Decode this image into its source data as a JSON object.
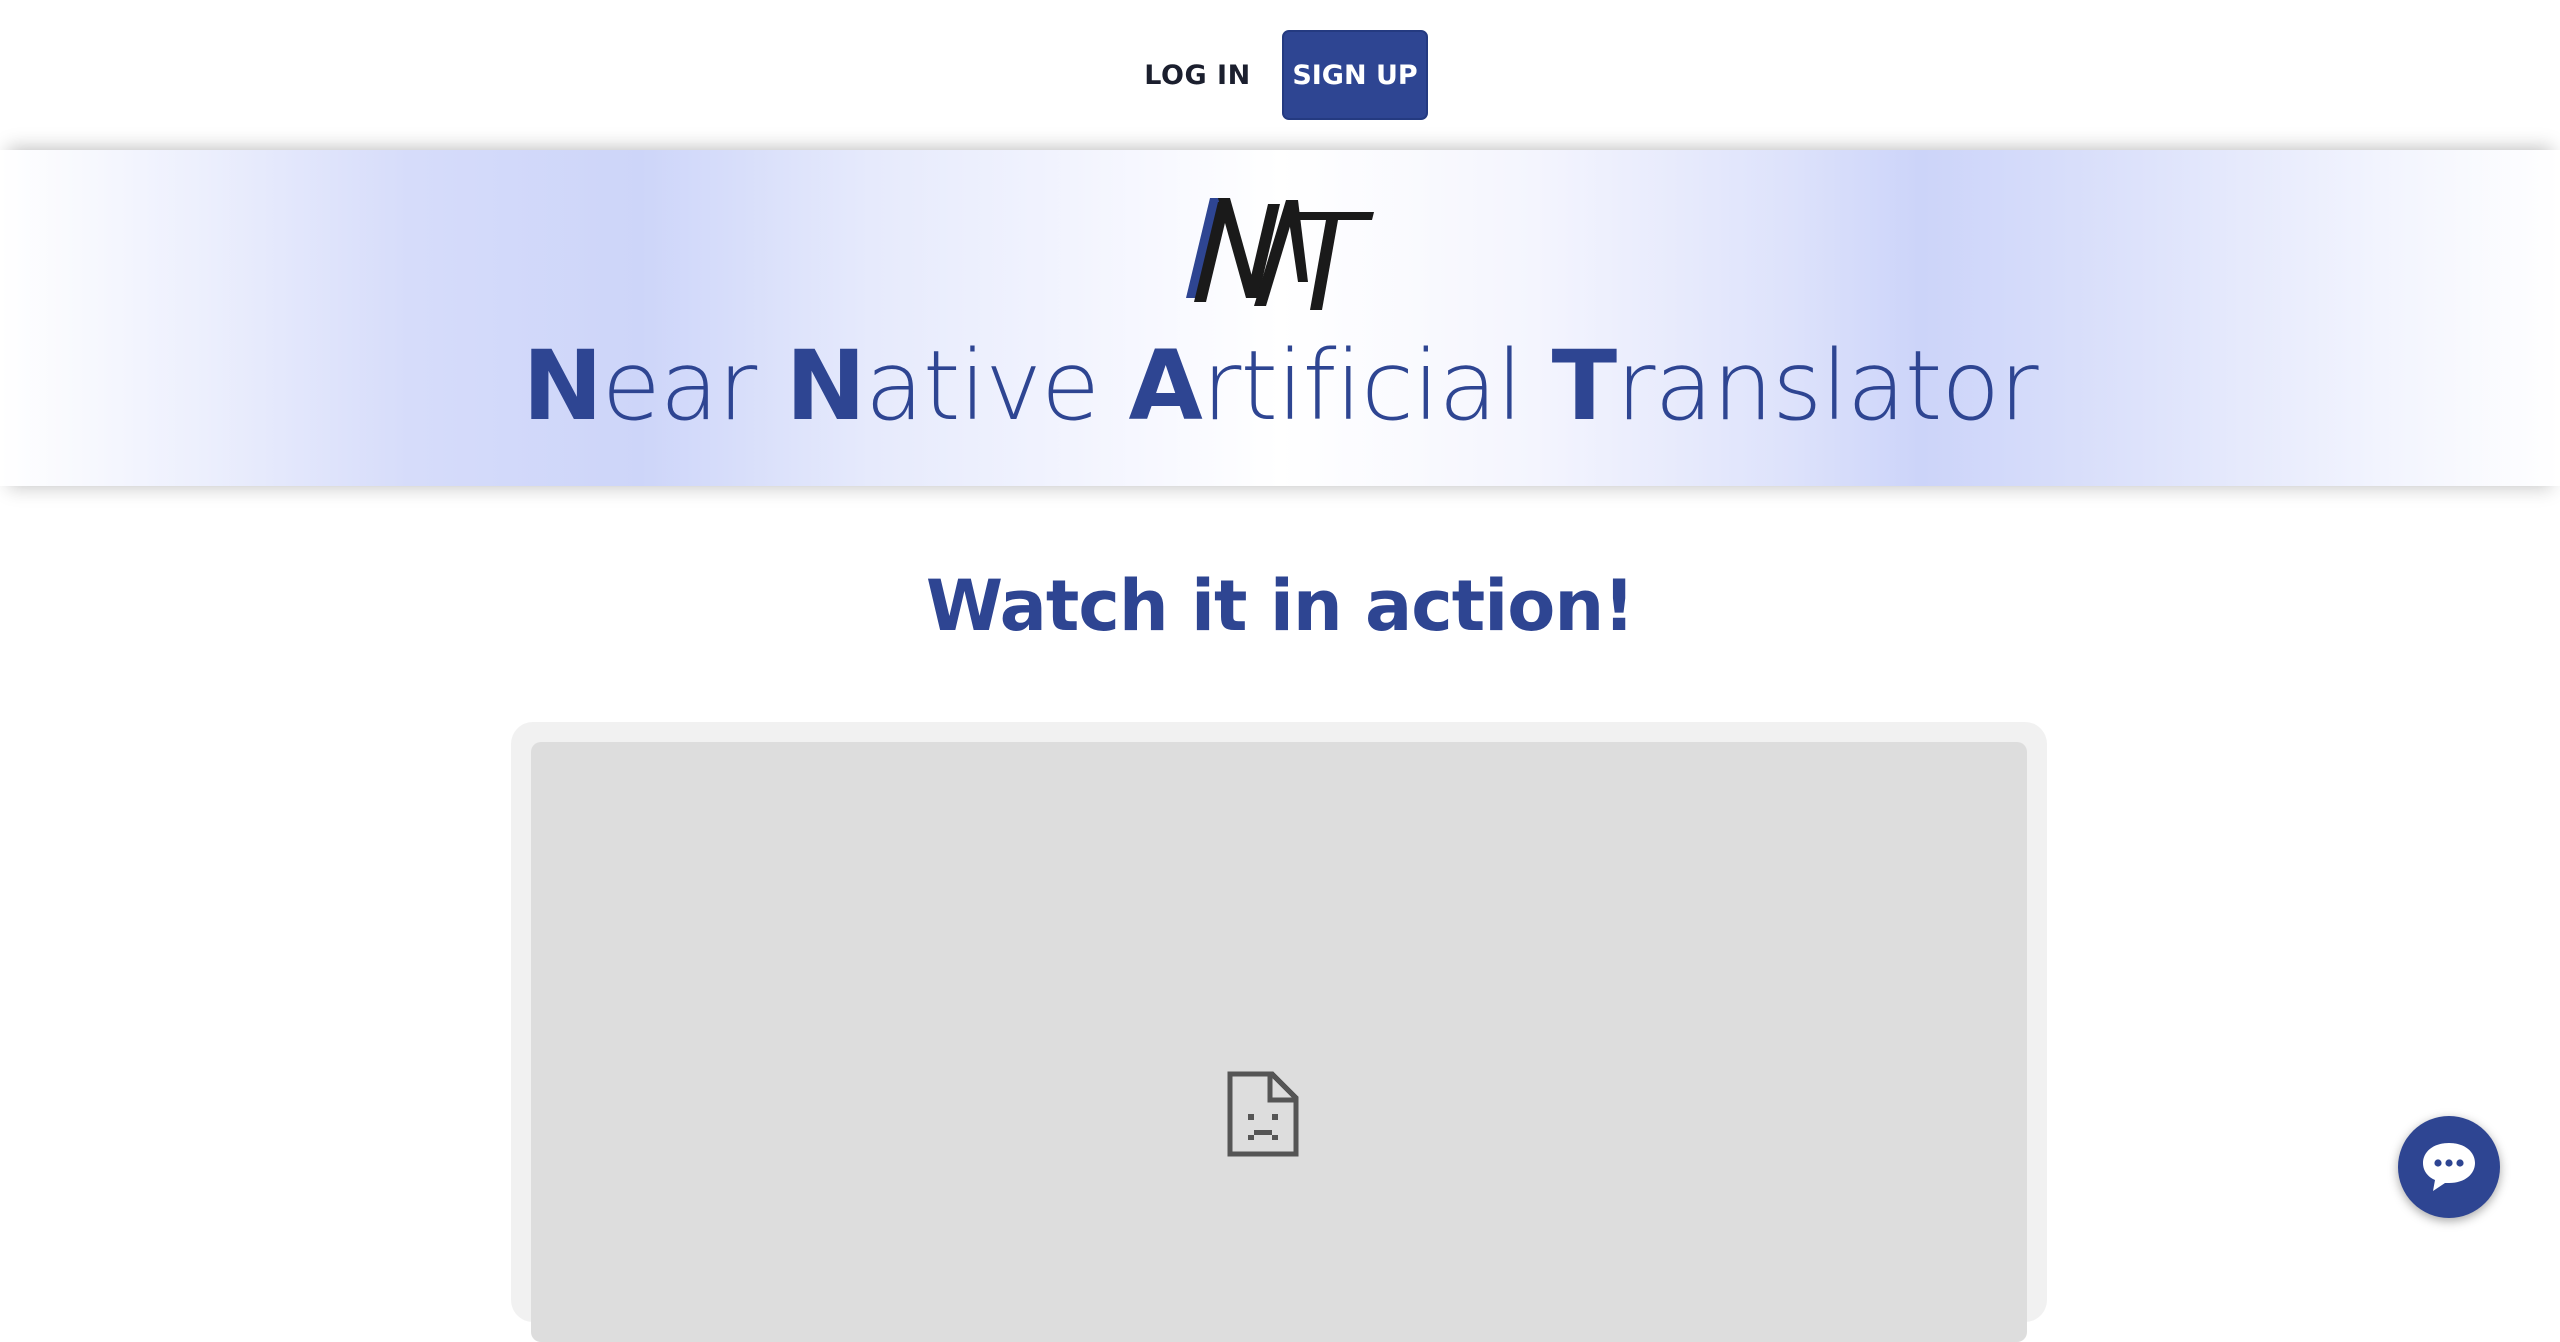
{
  "header": {
    "login_label": "LOG IN",
    "signup_label": "SIGN UP"
  },
  "hero": {
    "logo_text": "NAT",
    "title_words": [
      {
        "initial": "N",
        "rest": "ear"
      },
      {
        "initial": "N",
        "rest": "ative"
      },
      {
        "initial": "A",
        "rest": "rtificial"
      },
      {
        "initial": "T",
        "rest": "ranslator"
      }
    ]
  },
  "main": {
    "heading": "Watch it in action!"
  },
  "icons": {
    "broken_media": "broken-file-icon",
    "chat": "chat-bubble-icon"
  },
  "colors": {
    "brand": "#2e4592",
    "signup_bg": "#2e4592",
    "video_placeholder": "#dddddd"
  }
}
